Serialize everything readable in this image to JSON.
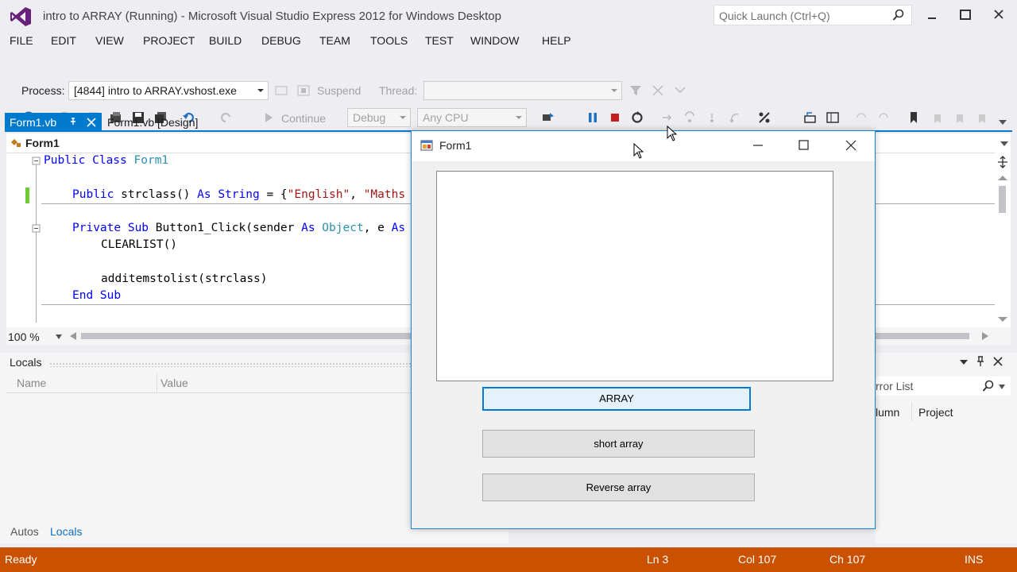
{
  "window": {
    "title": "intro to ARRAY (Running) - Microsoft Visual Studio Express 2012 for Windows Desktop",
    "quick_launch_placeholder": "Quick Launch (Ctrl+Q)"
  },
  "menu": [
    "FILE",
    "EDIT",
    "VIEW",
    "PROJECT",
    "BUILD",
    "DEBUG",
    "TEAM",
    "TOOLS",
    "TEST",
    "WINDOW",
    "HELP"
  ],
  "toolbar": {
    "continue_label": "Continue",
    "config_value": "Debug",
    "platform_value": "Any CPU",
    "process_label": "Process:",
    "process_value": "[4844] intro to ARRAY.vshost.exe",
    "suspend_label": "Suspend",
    "thread_label": "Thread:"
  },
  "tabs": [
    {
      "label": "Form1.vb",
      "active": true
    },
    {
      "label": "Form1.vb [Design]",
      "active": false
    }
  ],
  "editor": {
    "nav_class": "Form1",
    "zoom": "100 %",
    "lines": {
      "l1_kw": "Public Class ",
      "l1_ty": "Form1",
      "l2_kw1": "Public ",
      "l2_txt1": "strclass() ",
      "l2_kw2": "As ",
      "l2_ty": "String",
      "l2_txt2": " = {",
      "l2_str1": "\"English\"",
      "l2_txt3": ", ",
      "l2_str2": "\"Maths",
      "l3_kw1": "Private Sub ",
      "l3_txt1": "Button1_Click(sender ",
      "l3_kw2": "As ",
      "l3_ty": "Object",
      "l3_txt2": ", e ",
      "l3_kw3": "As",
      "l4_txt": "CLEARLIST()",
      "l5_txt": "additemstolist(strclass)",
      "l6_kw": "End Sub"
    }
  },
  "locals": {
    "title": "Locals",
    "col_name": "Name",
    "col_value": "Value",
    "tab_autos": "Autos",
    "tab_locals": "Locals"
  },
  "errorlist": {
    "title_partial": "rror List",
    "col_column_partial": "lumn",
    "col_project": "Project"
  },
  "status": {
    "state": "Ready",
    "ln": "Ln 3",
    "col": "Col 107",
    "ch": "Ch 107",
    "mode": "INS"
  },
  "form1": {
    "title": "Form1",
    "btn_array": "ARRAY",
    "btn_short": "short array",
    "btn_reverse": "Reverse array"
  },
  "colors": {
    "accent": "#007acc",
    "status_bar": "#ca5100",
    "keyword": "#0000ff",
    "type": "#2b91af",
    "string": "#a31515"
  }
}
